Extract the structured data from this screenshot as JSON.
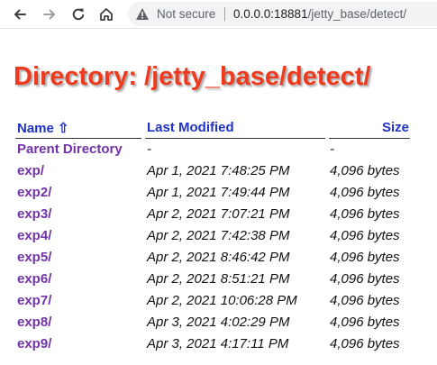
{
  "browser": {
    "security_label": "Not secure",
    "url_host": "0.0.0.0:18881",
    "url_path": "/jetty_base/detect/"
  },
  "page": {
    "heading": "Directory: /jetty_base/detect/",
    "columns": {
      "name": "Name  ⇧",
      "modified": "Last Modified",
      "size": "Size"
    },
    "rows": [
      {
        "name": "Parent Directory",
        "modified": "-",
        "size": "-"
      },
      {
        "name": "exp/",
        "modified": "Apr 1, 2021 7:48:25 PM",
        "size": "4,096 bytes"
      },
      {
        "name": "exp2/",
        "modified": "Apr 1, 2021 7:49:44 PM",
        "size": "4,096 bytes"
      },
      {
        "name": "exp3/",
        "modified": "Apr 2, 2021 7:07:21 PM",
        "size": "4,096 bytes"
      },
      {
        "name": "exp4/",
        "modified": "Apr 2, 2021 7:42:38 PM",
        "size": "4,096 bytes"
      },
      {
        "name": "exp5/",
        "modified": "Apr 2, 2021 8:46:42 PM",
        "size": "4,096 bytes"
      },
      {
        "name": "exp6/",
        "modified": "Apr 2, 2021 8:51:21 PM",
        "size": "4,096 bytes"
      },
      {
        "name": "exp7/",
        "modified": "Apr 2, 2021 10:06:28 PM",
        "size": "4,096 bytes"
      },
      {
        "name": "exp8/",
        "modified": "Apr 3, 2021 4:02:29 PM",
        "size": "4,096 bytes"
      },
      {
        "name": "exp9/",
        "modified": "Apr 3, 2021 4:17:11 PM",
        "size": "4,096 bytes"
      }
    ]
  },
  "colors": {
    "heading": "#ee3b1f",
    "link": "#7233a8",
    "header_link": "#1f32c7"
  },
  "icons": [
    "back-arrow-icon",
    "forward-arrow-icon",
    "reload-icon",
    "home-icon",
    "warning-triangle-icon"
  ]
}
